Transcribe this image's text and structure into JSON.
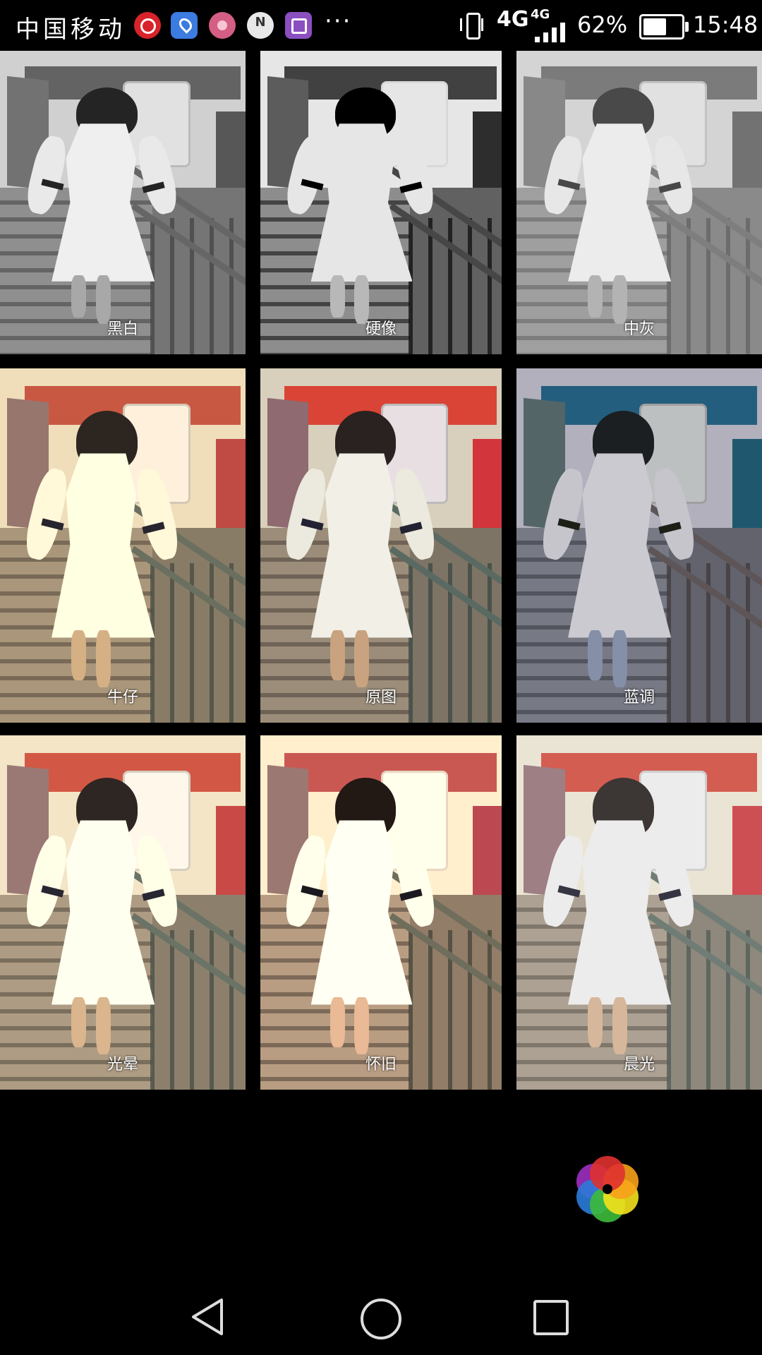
{
  "status_bar": {
    "carrier": "中国移动",
    "app_icons": [
      "netease-music-icon",
      "map-pin-icon",
      "flower-app-icon",
      "nexus-app-icon",
      "gallery-app-icon"
    ],
    "more": "···",
    "network_primary": "4G",
    "network_secondary": "4G",
    "battery_percent": "62%",
    "battery_level": 0.62,
    "time": "15:48"
  },
  "filters": [
    {
      "label": "黑白",
      "selected": false
    },
    {
      "label": "硬像",
      "selected": false
    },
    {
      "label": "中灰",
      "selected": true
    },
    {
      "label": "牛仔",
      "selected": false
    },
    {
      "label": "原图",
      "selected": false
    },
    {
      "label": "蓝调",
      "selected": false
    },
    {
      "label": "光晕",
      "selected": false
    },
    {
      "label": "怀旧",
      "selected": false
    },
    {
      "label": "晨光",
      "selected": false
    }
  ],
  "colors": {
    "selection_border": "#22c9d8",
    "background": "#000000",
    "logo_petals": [
      "#e0312f",
      "#f7a11a",
      "#f4e21c",
      "#3dbb3a",
      "#2a7bd8",
      "#9c2fc0"
    ]
  },
  "nav_bar": {
    "back": "back-icon",
    "home": "home-icon",
    "recent": "recent-apps-icon"
  }
}
